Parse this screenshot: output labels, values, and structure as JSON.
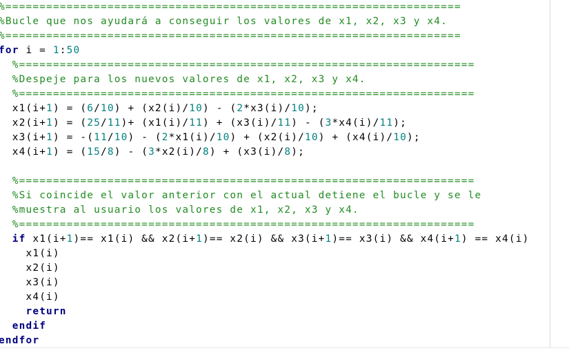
{
  "editor": {
    "lines": [
      {
        "indent": 0,
        "tokens": [
          {
            "t": "c",
            "v": "%==================================================================="
          }
        ]
      },
      {
        "indent": 0,
        "tokens": [
          {
            "t": "c",
            "v": "%Bucle que nos ayudará a conseguir los valores de x1, x2, x3 y x4."
          }
        ]
      },
      {
        "indent": 0,
        "tokens": [
          {
            "t": "c",
            "v": "%==================================================================="
          }
        ]
      },
      {
        "indent": 0,
        "tokens": [
          {
            "t": "k",
            "v": "for"
          },
          {
            "t": "x",
            "v": " i = "
          },
          {
            "t": "n",
            "v": "1"
          },
          {
            "t": "x",
            "v": ":"
          },
          {
            "t": "n",
            "v": "50"
          }
        ]
      },
      {
        "indent": 2,
        "tokens": [
          {
            "t": "c",
            "v": "%==================================================================="
          }
        ]
      },
      {
        "indent": 2,
        "tokens": [
          {
            "t": "c",
            "v": "%Despeje para los nuevos valores de x1, x2, x3 y x4."
          }
        ]
      },
      {
        "indent": 2,
        "tokens": [
          {
            "t": "c",
            "v": "%==================================================================="
          }
        ]
      },
      {
        "indent": 2,
        "tokens": [
          {
            "t": "x",
            "v": "x1(i+"
          },
          {
            "t": "n",
            "v": "1"
          },
          {
            "t": "x",
            "v": ") = ("
          },
          {
            "t": "n",
            "v": "6"
          },
          {
            "t": "x",
            "v": "/"
          },
          {
            "t": "n",
            "v": "10"
          },
          {
            "t": "x",
            "v": ") + (x2(i)/"
          },
          {
            "t": "n",
            "v": "10"
          },
          {
            "t": "x",
            "v": ") - ("
          },
          {
            "t": "n",
            "v": "2"
          },
          {
            "t": "x",
            "v": "*x3(i)/"
          },
          {
            "t": "n",
            "v": "10"
          },
          {
            "t": "x",
            "v": ");"
          }
        ]
      },
      {
        "indent": 2,
        "tokens": [
          {
            "t": "x",
            "v": "x2(i+"
          },
          {
            "t": "n",
            "v": "1"
          },
          {
            "t": "x",
            "v": ") = ("
          },
          {
            "t": "n",
            "v": "25"
          },
          {
            "t": "x",
            "v": "/"
          },
          {
            "t": "n",
            "v": "11"
          },
          {
            "t": "x",
            "v": ")+ (x1(i)/"
          },
          {
            "t": "n",
            "v": "11"
          },
          {
            "t": "x",
            "v": ") + (x3(i)/"
          },
          {
            "t": "n",
            "v": "11"
          },
          {
            "t": "x",
            "v": ") - ("
          },
          {
            "t": "n",
            "v": "3"
          },
          {
            "t": "x",
            "v": "*x4(i)/"
          },
          {
            "t": "n",
            "v": "11"
          },
          {
            "t": "x",
            "v": ");"
          }
        ]
      },
      {
        "indent": 2,
        "tokens": [
          {
            "t": "x",
            "v": "x3(i+"
          },
          {
            "t": "n",
            "v": "1"
          },
          {
            "t": "x",
            "v": ") = -("
          },
          {
            "t": "n",
            "v": "11"
          },
          {
            "t": "x",
            "v": "/"
          },
          {
            "t": "n",
            "v": "10"
          },
          {
            "t": "x",
            "v": ") - ("
          },
          {
            "t": "n",
            "v": "2"
          },
          {
            "t": "x",
            "v": "*x1(i)/"
          },
          {
            "t": "n",
            "v": "10"
          },
          {
            "t": "x",
            "v": ") + (x2(i)/"
          },
          {
            "t": "n",
            "v": "10"
          },
          {
            "t": "x",
            "v": ") + (x4(i)/"
          },
          {
            "t": "n",
            "v": "10"
          },
          {
            "t": "x",
            "v": ");"
          }
        ]
      },
      {
        "indent": 2,
        "tokens": [
          {
            "t": "x",
            "v": "x4(i+"
          },
          {
            "t": "n",
            "v": "1"
          },
          {
            "t": "x",
            "v": ") = ("
          },
          {
            "t": "n",
            "v": "15"
          },
          {
            "t": "x",
            "v": "/"
          },
          {
            "t": "n",
            "v": "8"
          },
          {
            "t": "x",
            "v": ") - ("
          },
          {
            "t": "n",
            "v": "3"
          },
          {
            "t": "x",
            "v": "*x2(i)/"
          },
          {
            "t": "n",
            "v": "8"
          },
          {
            "t": "x",
            "v": ") + (x3(i)/"
          },
          {
            "t": "n",
            "v": "8"
          },
          {
            "t": "x",
            "v": ");"
          }
        ]
      },
      {
        "indent": 0,
        "tokens": []
      },
      {
        "indent": 2,
        "tokens": [
          {
            "t": "c",
            "v": "%==================================================================="
          }
        ]
      },
      {
        "indent": 2,
        "tokens": [
          {
            "t": "c",
            "v": "%Si coincide el valor anterior con el actual detiene el bucle y se le"
          }
        ]
      },
      {
        "indent": 2,
        "tokens": [
          {
            "t": "c",
            "v": "%muestra al usuario los valores de x1, x2, x3 y x4."
          }
        ]
      },
      {
        "indent": 2,
        "tokens": [
          {
            "t": "c",
            "v": "%==================================================================="
          }
        ]
      },
      {
        "indent": 2,
        "tokens": [
          {
            "t": "k",
            "v": "if"
          },
          {
            "t": "x",
            "v": " x1(i+"
          },
          {
            "t": "n",
            "v": "1"
          },
          {
            "t": "x",
            "v": ")== x1(i) && x2(i+"
          },
          {
            "t": "n",
            "v": "1"
          },
          {
            "t": "x",
            "v": ")== x2(i) && x3(i+"
          },
          {
            "t": "n",
            "v": "1"
          },
          {
            "t": "x",
            "v": ")== x3(i) && x4(i+"
          },
          {
            "t": "n",
            "v": "1"
          },
          {
            "t": "x",
            "v": ") == x4(i)"
          }
        ]
      },
      {
        "indent": 4,
        "tokens": [
          {
            "t": "x",
            "v": "x1(i)"
          }
        ]
      },
      {
        "indent": 4,
        "tokens": [
          {
            "t": "x",
            "v": "x2(i)"
          }
        ]
      },
      {
        "indent": 4,
        "tokens": [
          {
            "t": "x",
            "v": "x3(i)"
          }
        ]
      },
      {
        "indent": 4,
        "tokens": [
          {
            "t": "x",
            "v": "x4(i)"
          }
        ]
      },
      {
        "indent": 4,
        "tokens": [
          {
            "t": "k",
            "v": "return"
          }
        ]
      },
      {
        "indent": 2,
        "tokens": [
          {
            "t": "k",
            "v": "endif"
          }
        ]
      },
      {
        "indent": 0,
        "tokens": [
          {
            "t": "k",
            "v": "endfor"
          }
        ]
      }
    ]
  },
  "theme": {
    "comment_color": "#228b22",
    "keyword_color": "#000080",
    "number_color": "#008080",
    "text_color": "#000000",
    "background_color": "#ffffff"
  }
}
